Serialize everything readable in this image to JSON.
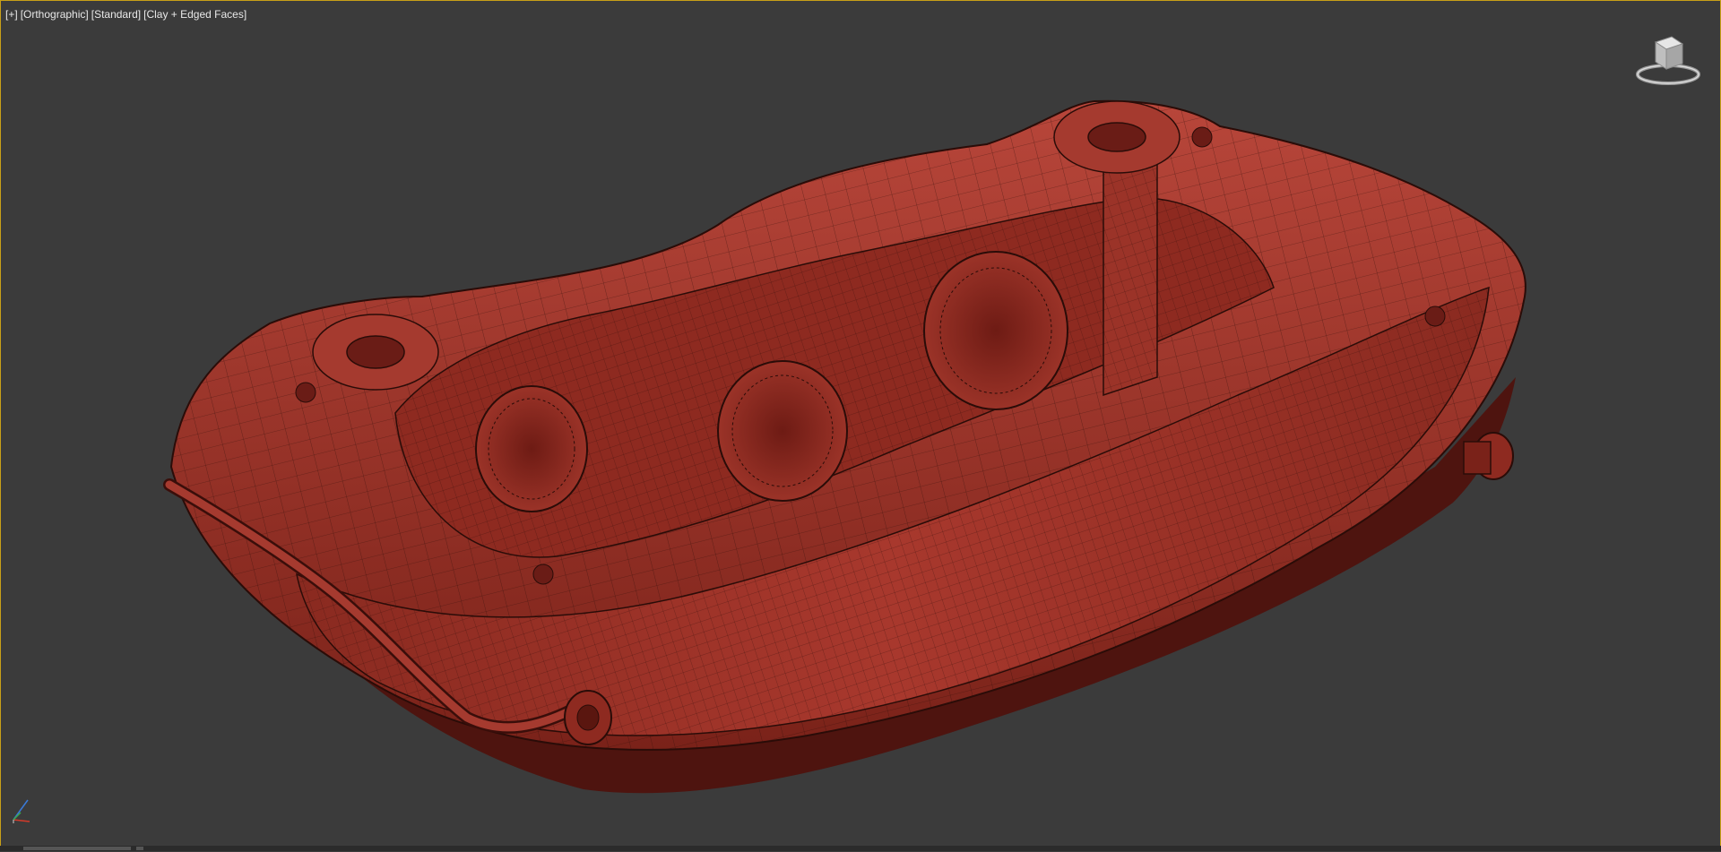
{
  "viewport": {
    "labels": {
      "plus": "[+]",
      "view": "[Orthographic]",
      "shading": "[Standard]",
      "mode": "[Clay + Edged Faces]"
    },
    "viewcube_icon": "viewcube-icon",
    "axis_icon": "axis-tripod-icon",
    "model_icon": "brake-caliper-wireframe",
    "colors": {
      "background": "#3b3b3b",
      "border_active": "#c8a018",
      "clay": "#a83a30",
      "clay_dark": "#6a1c16",
      "edge": "#2a0c08"
    }
  }
}
